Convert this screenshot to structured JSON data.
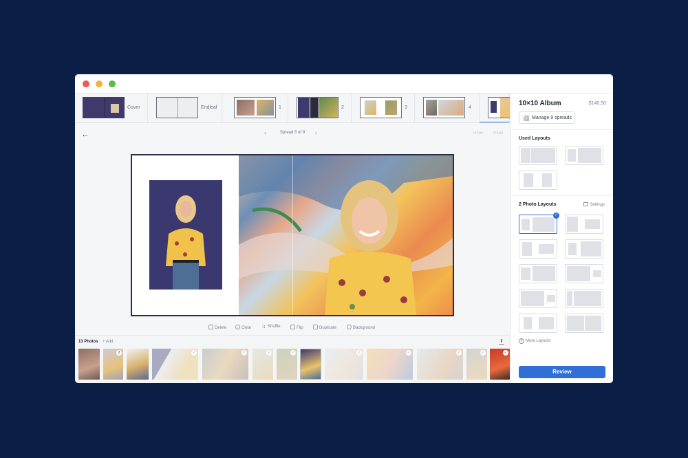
{
  "window": {
    "controls": [
      "close",
      "minimize",
      "zoom"
    ]
  },
  "spreads": [
    {
      "label": "Cover"
    },
    {
      "label": "Endleaf"
    },
    {
      "label": "1"
    },
    {
      "label": "2"
    },
    {
      "label": "3"
    },
    {
      "label": "4"
    },
    {
      "label": "",
      "active": true
    }
  ],
  "panel": {
    "album_title": "10×10 Album",
    "price": "$140.50",
    "manage_label": "Manage 9 spreads",
    "used_layouts_title": "Used Layouts",
    "photo_layouts_title": "2 Photo Layouts",
    "settings_label": "Settings",
    "more_layouts_label": "More Layouts",
    "review_label": "Review"
  },
  "editor": {
    "spread_label": "Spread 5 of 9",
    "undo_label": "Undo",
    "redo_label": "Redo"
  },
  "toolbar": {
    "delete": "Delete",
    "clear": "Clear",
    "shuffle": "Shuffle",
    "flip": "Flip",
    "duplicate": "Duplicate",
    "background": "Background"
  },
  "tray": {
    "count_label": "13 Photos",
    "add_label": "Add",
    "badges": [
      "",
      "2",
      "",
      "✓",
      "✓",
      "✓",
      "✓",
      "✓",
      "",
      "✓",
      "✓",
      "✓",
      "✓",
      "✓",
      ""
    ]
  },
  "colors": {
    "background": "#0b1e45",
    "accent": "#2f6fd6",
    "selected_check": "#2f6fd6"
  },
  "icons": [
    "back-arrow-icon",
    "chevron-left-icon",
    "chevron-right-icon",
    "grid-icon",
    "gear-icon",
    "plus-icon",
    "upload-icon",
    "trash-icon",
    "clear-icon",
    "shuffle-icon",
    "flip-icon",
    "duplicate-icon",
    "background-icon",
    "check-icon"
  ]
}
